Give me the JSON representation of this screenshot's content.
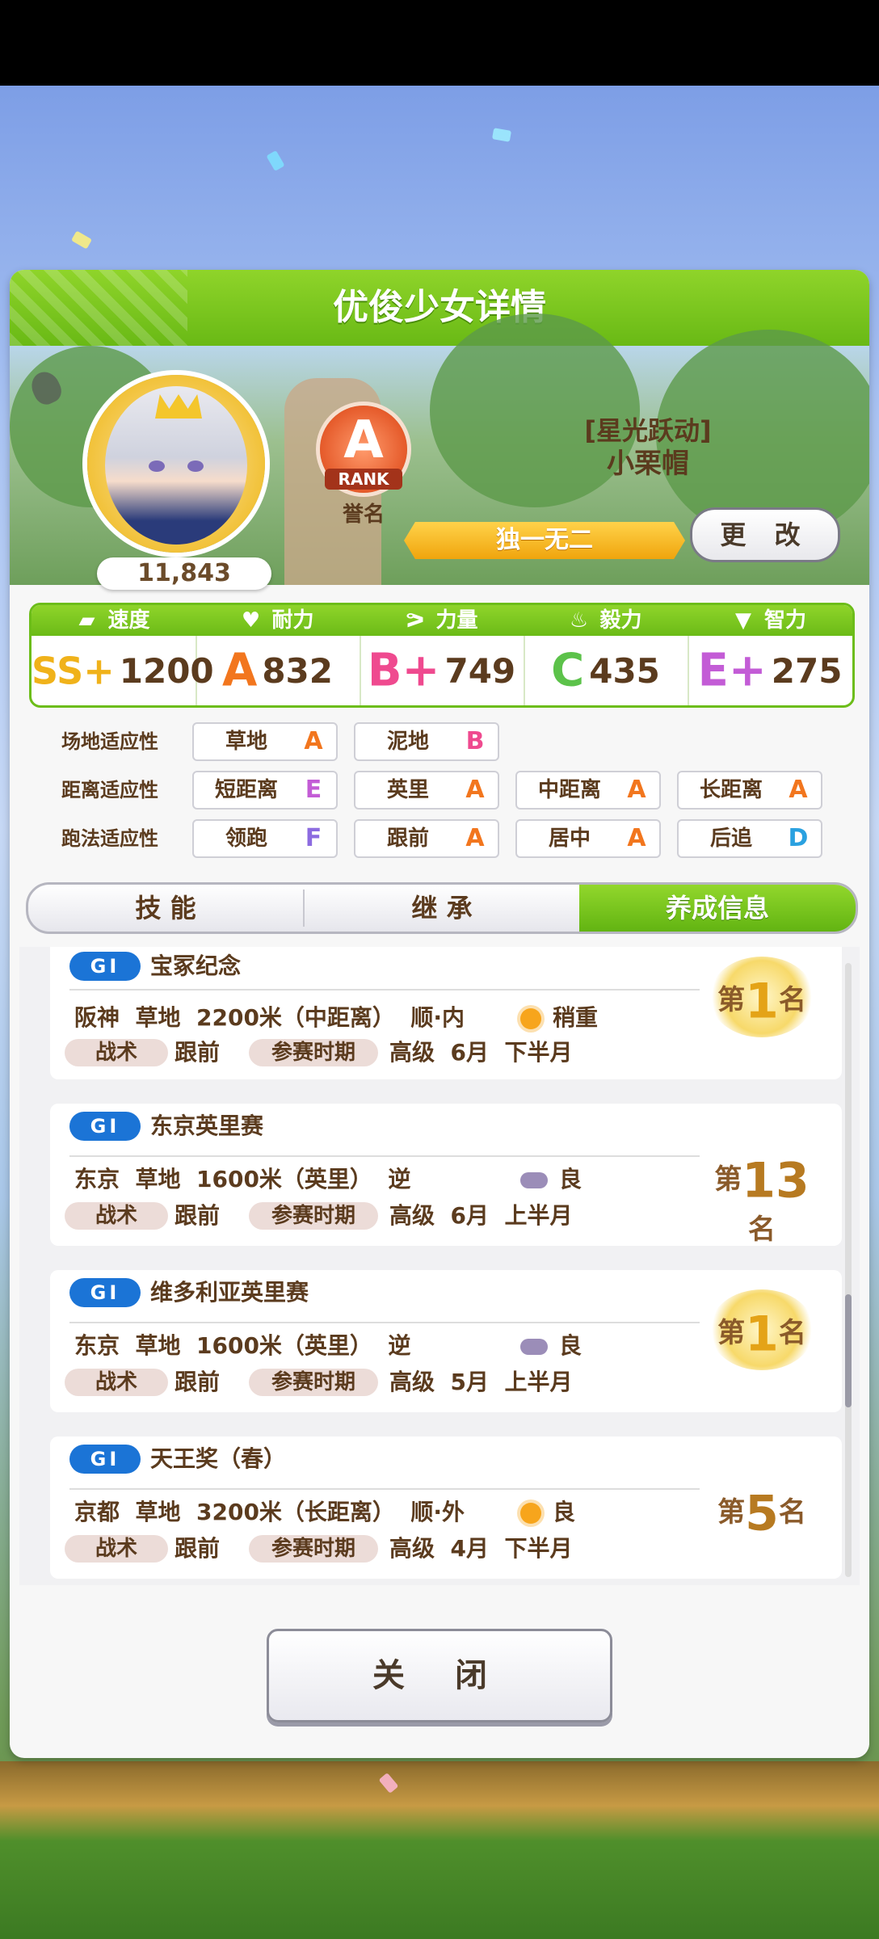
{
  "panel": {
    "title": "优俊少女详情"
  },
  "profile": {
    "fans": "11,843",
    "rank": {
      "letter": "A",
      "word": "RANK",
      "label": "誉名"
    },
    "title": "[星光跃动]",
    "name": "小栗帽",
    "unique": "独一无二",
    "change_label": "更 改"
  },
  "stats": [
    {
      "label": "速度",
      "icon": "shoe-icon",
      "grade": "SS+",
      "value": "1200"
    },
    {
      "label": "耐力",
      "icon": "heart-icon",
      "grade": "A",
      "value": "832"
    },
    {
      "label": "力量",
      "icon": "muscle-icon",
      "grade": "B+",
      "value": "749"
    },
    {
      "label": "毅力",
      "icon": "flame-icon",
      "grade": "C",
      "value": "435"
    },
    {
      "label": "智力",
      "icon": "graduation-cap-icon",
      "grade": "E+",
      "value": "275"
    }
  ],
  "aptitude": {
    "track": {
      "label": "场地适应性",
      "items": [
        {
          "name": "草地",
          "grade": "A"
        },
        {
          "name": "泥地",
          "grade": "B"
        }
      ]
    },
    "distance": {
      "label": "距离适应性",
      "items": [
        {
          "name": "短距离",
          "grade": "E"
        },
        {
          "name": "英里",
          "grade": "A"
        },
        {
          "name": "中距离",
          "grade": "A"
        },
        {
          "name": "长距离",
          "grade": "A"
        }
      ]
    },
    "style": {
      "label": "跑法适应性",
      "items": [
        {
          "name": "领跑",
          "grade": "F"
        },
        {
          "name": "跟前",
          "grade": "A"
        },
        {
          "name": "居中",
          "grade": "A"
        },
        {
          "name": "后追",
          "grade": "D"
        }
      ]
    }
  },
  "tabs": [
    {
      "label": "技 能"
    },
    {
      "label": "继 承"
    },
    {
      "label": "养成信息"
    }
  ],
  "races": [
    {
      "grade": "GI",
      "name": "宝冢纪念",
      "info": "阪神  草地  2200米（中距离）  顺·内",
      "weather_icon": "sun-icon",
      "weather": "稍重",
      "tactic_label": "战术",
      "tactic": "跟前",
      "period_label": "参赛时期",
      "period": "高级  6月  下半月",
      "place_prefix": "第",
      "place": "1",
      "place_suffix": "名"
    },
    {
      "grade": "GI",
      "name": "东京英里赛",
      "info": "东京  草地  1600米（英里）  逆",
      "weather_icon": "cloud-icon",
      "weather": "良",
      "tactic_label": "战术",
      "tactic": "跟前",
      "period_label": "参赛时期",
      "period": "高级  6月  上半月",
      "place_prefix": "第",
      "place": "13",
      "place_suffix": "名"
    },
    {
      "grade": "GI",
      "name": "维多利亚英里赛",
      "info": "东京  草地  1600米（英里）  逆",
      "weather_icon": "cloud-icon",
      "weather": "良",
      "tactic_label": "战术",
      "tactic": "跟前",
      "period_label": "参赛时期",
      "period": "高级  5月  上半月",
      "place_prefix": "第",
      "place": "1",
      "place_suffix": "名"
    },
    {
      "grade": "GI",
      "name": "天王奖（春）",
      "info": "京都  草地  3200米（长距离）  顺·外",
      "weather_icon": "sun-icon",
      "weather": "良",
      "tactic_label": "战术",
      "tactic": "跟前",
      "period_label": "参赛时期",
      "period": "高级  4月  下半月",
      "place_prefix": "第",
      "place": "5",
      "place_suffix": "名"
    }
  ],
  "close_label": "关 闭",
  "colors": {
    "header_green": "#69b915",
    "gi_blue": "#1b74d6",
    "text_brown": "#5b3b1e"
  }
}
